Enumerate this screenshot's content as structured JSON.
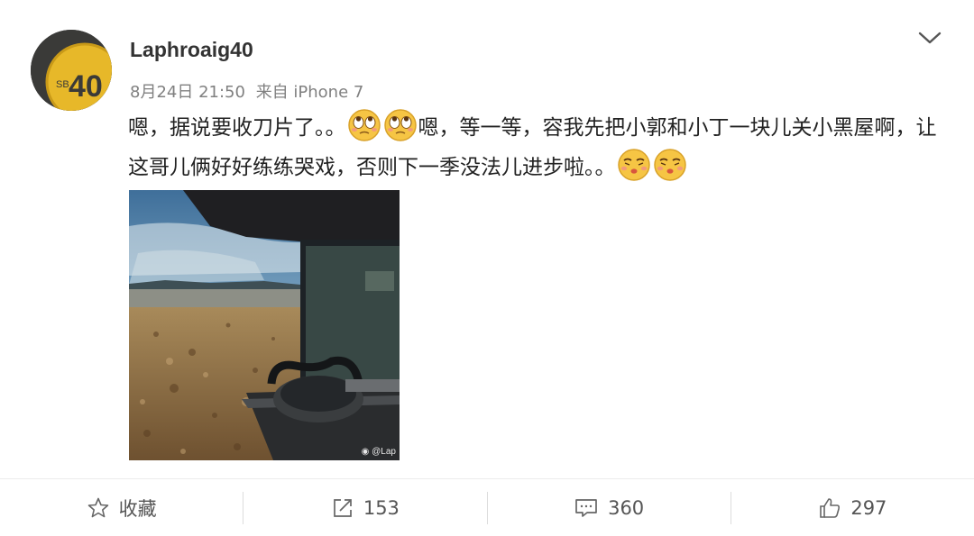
{
  "post": {
    "username": "Laphroaig40",
    "date": "8月24日 21:50",
    "source": "来自 iPhone 7",
    "avatar_text": "40",
    "avatar_small_text": "SB",
    "content_part1": "嗯，据说要收刀片了。。",
    "content_part2": "嗯，等一等，容我先把小郭和小丁一块儿关小黑屋啊，让这哥儿俩好好练练哭戏，否则下一季没法儿进步啦。。",
    "photo_watermark": "@Lap",
    "emojis": [
      "rolling-eyes-emoji",
      "rolling-eyes-emoji",
      "kiss-emoji",
      "kiss-emoji"
    ]
  },
  "actions": {
    "favorite_label": "收藏",
    "repost_count": "153",
    "comment_count": "360",
    "like_count": "297"
  },
  "icons": [
    "chevron-down-icon",
    "star-icon",
    "repost-icon",
    "comment-icon",
    "thumbs-up-icon"
  ]
}
